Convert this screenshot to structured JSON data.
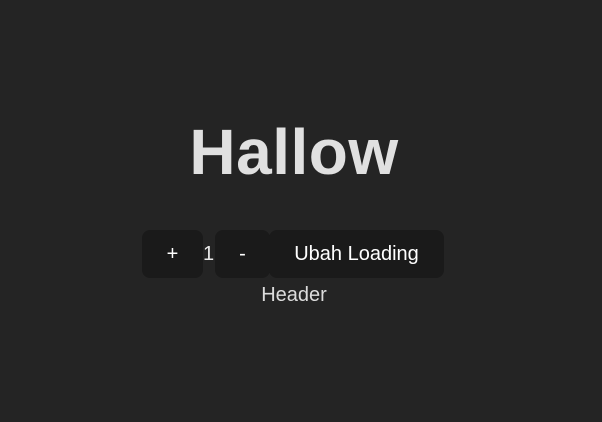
{
  "main": {
    "title": "Hallow",
    "counter": {
      "increment_label": "+",
      "value": "1",
      "decrement_label": "-"
    },
    "loading_button_label": "Ubah Loading",
    "header_label": "Header"
  },
  "colors": {
    "background": "#242424",
    "button_background": "#1a1a1a",
    "text": "#e0e0e0"
  }
}
